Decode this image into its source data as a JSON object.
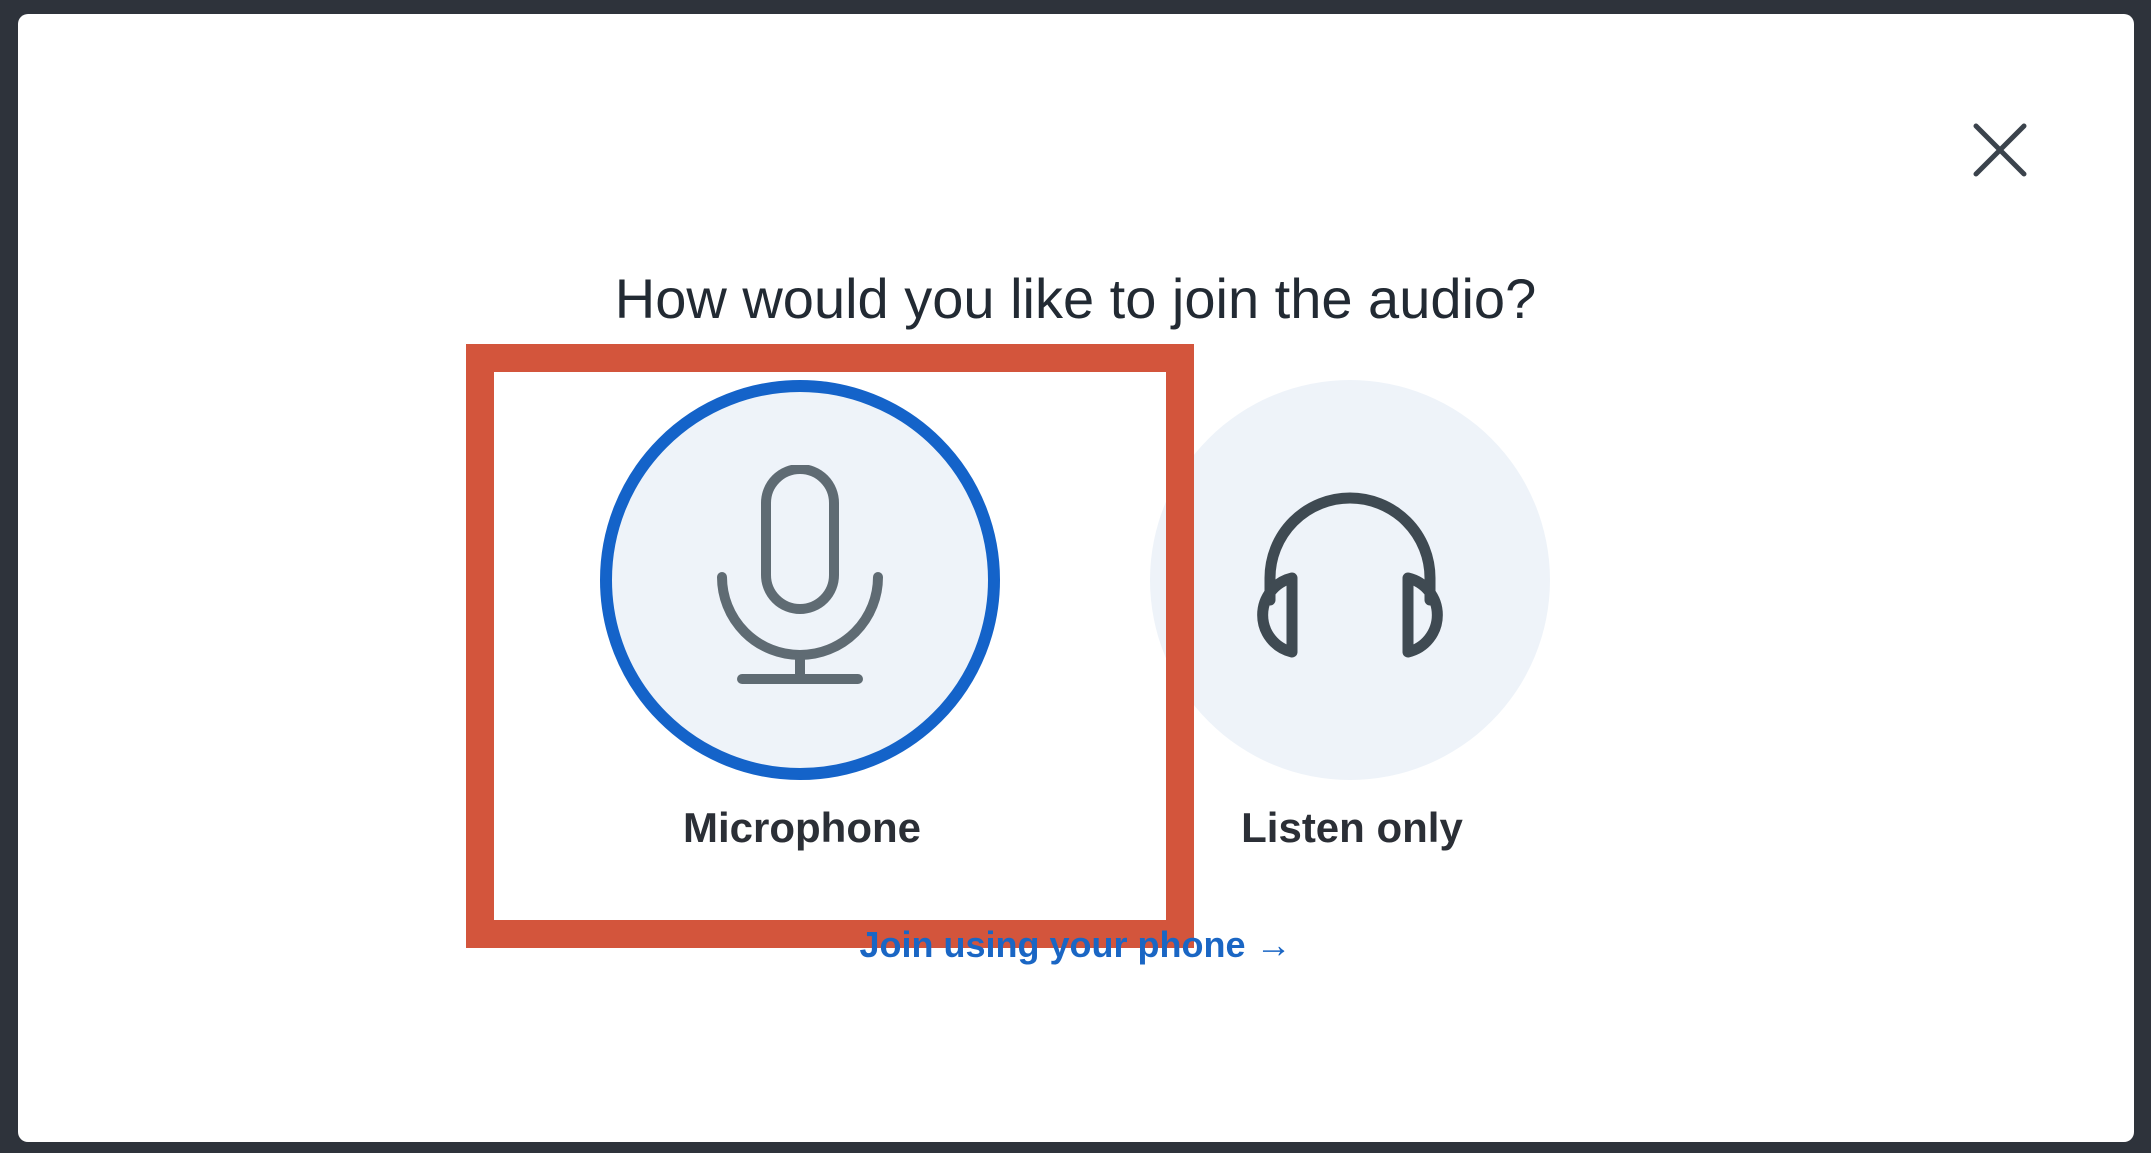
{
  "dialog": {
    "title": "How would you like to join the audio?",
    "close_icon": "close-icon"
  },
  "options": [
    {
      "label": "Microphone",
      "icon": "microphone-icon",
      "selected": true
    },
    {
      "label": "Listen only",
      "icon": "headphones-icon",
      "selected": false
    }
  ],
  "phone_link": {
    "label": "Join using your phone →"
  },
  "colors": {
    "accent": "#1463c9",
    "highlight": "#d3553c",
    "icon": "#5f6b73",
    "circle_bg": "#eef3f9",
    "link": "#1a66c4"
  }
}
